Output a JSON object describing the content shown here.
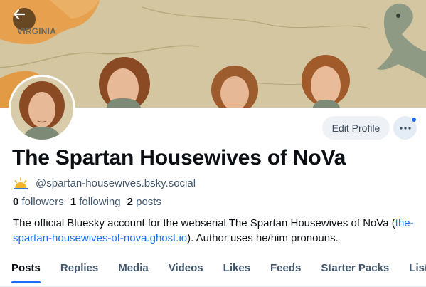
{
  "banner": {
    "word": "VIRGINIA",
    "back_icon": "arrow-left-icon"
  },
  "profile": {
    "display_name": "The Spartan Housewives of NoVa",
    "handle_icon": "sun-icon",
    "handle": "@spartan-housewives.bsky.social"
  },
  "actions": {
    "edit_profile_label": "Edit Profile",
    "more_icon": "more-horizontal-icon"
  },
  "stats": {
    "followers_count": "0",
    "followers_label": "followers",
    "following_count": "1",
    "following_label": "following",
    "posts_count": "2",
    "posts_label": "posts"
  },
  "bio": {
    "text_before": "The official Bluesky account for the webserial The Spartan Housewives of NoVa (",
    "link": "the-spartan-housewives-of-nova.ghost.io",
    "text_after": "). Author uses he/him pronouns."
  },
  "tabs": [
    {
      "label": "Posts",
      "active": true
    },
    {
      "label": "Replies"
    },
    {
      "label": "Media"
    },
    {
      "label": "Videos"
    },
    {
      "label": "Likes"
    },
    {
      "label": "Feeds"
    },
    {
      "label": "Starter Packs"
    },
    {
      "label": "Lists"
    }
  ],
  "colors": {
    "accent": "#1b6ef3",
    "muted_text": "#42576c",
    "banner_bg": "#cdbf98"
  }
}
